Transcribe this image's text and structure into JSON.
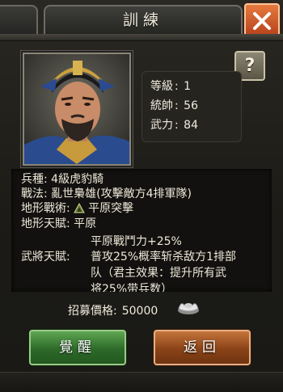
{
  "header": {
    "title": "訓練"
  },
  "general": {
    "stats": [
      {
        "label": "等級",
        "value": "1"
      },
      {
        "label": "統帥",
        "value": "56"
      },
      {
        "label": "武力",
        "value": "84"
      }
    ]
  },
  "info": {
    "troop_label": "兵種",
    "troop_value": "4級虎豹騎",
    "tactic_label": "戰法",
    "tactic_value": "亂世梟雄(攻擊敵方4排軍隊)",
    "terrain_tactic_label": "地形戰術",
    "terrain_tactic_value": "平原突擊",
    "terrain_talent_label": "地形天賦",
    "terrain_talent_value": "平原",
    "general_talent_label": "武將天賦",
    "talent_lines": [
      "平原戰鬥力+25%",
      "普攻25%概率斩杀敌方1排部",
      "队（君主效果：提升所有武",
      "将25%带兵数）"
    ]
  },
  "recruit": {
    "label": "招募價格",
    "value": "50000"
  },
  "buttons": {
    "awaken": "覺醒",
    "return": "返回"
  },
  "help_label": "?",
  "icons": [
    "close-icon",
    "help-icon",
    "terrain-icon",
    "silver-ingot-icon"
  ]
}
